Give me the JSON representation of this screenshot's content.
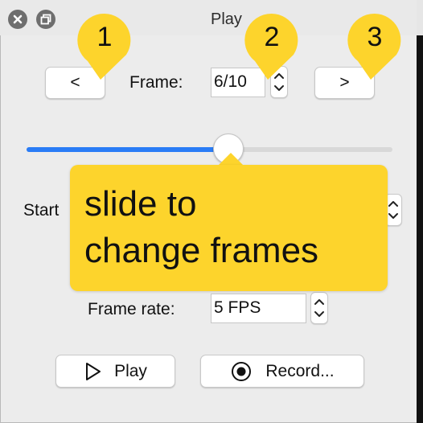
{
  "window": {
    "title": "Play"
  },
  "navigation": {
    "prev_label": "<",
    "next_label": ">",
    "frame_label": "Frame:",
    "frame_value": "6/10"
  },
  "slider": {
    "current_frame": 6,
    "total_frames": 10
  },
  "start_label_partial": "Start",
  "frame_rate": {
    "label": "Frame rate:",
    "value": "5 FPS"
  },
  "actions": {
    "play_label": "Play",
    "record_label": "Record..."
  },
  "annotations": {
    "bubbles": [
      "1",
      "2",
      "3"
    ],
    "callout_lines": [
      "slide to",
      "change frames"
    ],
    "color": "#fdd42c"
  },
  "colors": {
    "accent": "#2a7cf6"
  }
}
